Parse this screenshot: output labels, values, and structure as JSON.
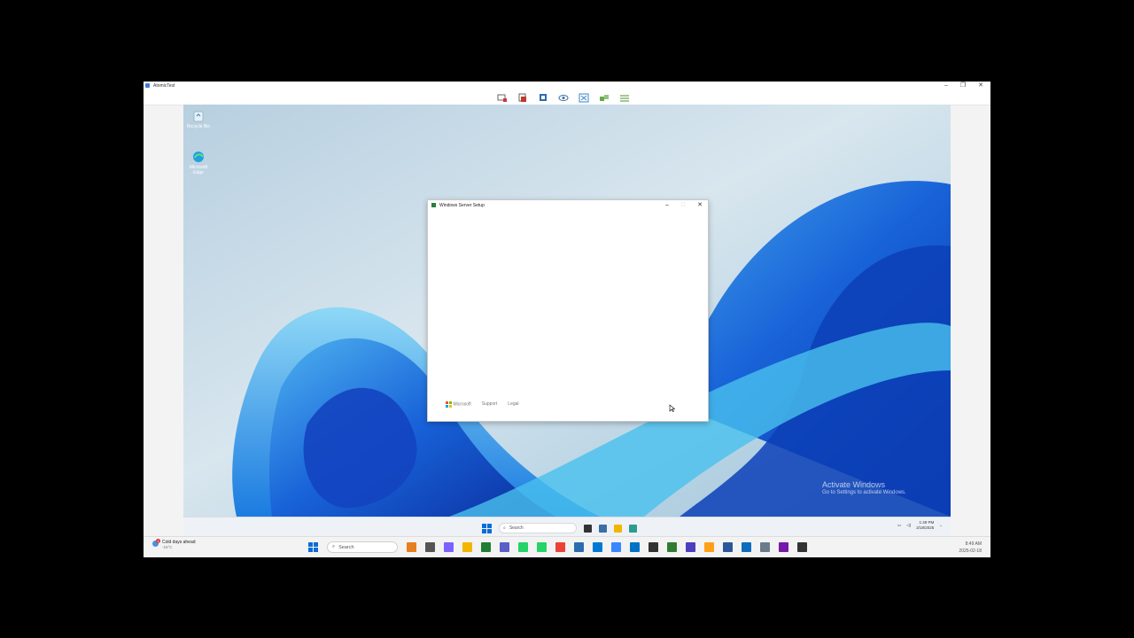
{
  "host_window": {
    "title": "AtomicTest",
    "controls": {
      "minimize": "–",
      "maximize": "❐",
      "close": "✕"
    },
    "toolbar_icons": [
      "ctrl-alt-del-icon",
      "turn-off-icon",
      "checkpoint-icon",
      "view-icon",
      "fullscreen-icon",
      "share-icon",
      "settings-icon"
    ]
  },
  "desktop": {
    "icons": [
      {
        "label": "Recycle Bin",
        "icon": "recycle-bin-icon"
      },
      {
        "label": "Microsoft Edge",
        "icon": "edge-icon"
      }
    ],
    "watermark": {
      "line1": "Activate Windows",
      "line2": "Go to Settings to activate Windows."
    }
  },
  "setup_dialog": {
    "title": "Windows Server Setup",
    "controls": {
      "minimize": "–",
      "maximize": "□",
      "close": "✕"
    },
    "footer": {
      "brand": "Microsoft",
      "support": "Support",
      "legal": "Legal"
    }
  },
  "vm_taskbar": {
    "search_placeholder": "Search",
    "pinned": [
      "task-view-icon",
      "server-manager-icon",
      "file-explorer-icon",
      "setup-icon"
    ],
    "time": "1:49 PM",
    "date": "2/18/2025"
  },
  "host_taskbar": {
    "weather": {
      "text": "Cold days ahead",
      "temp": "-15°C",
      "badge": "4"
    },
    "search_placeholder": "Search",
    "pinned_colors": [
      "#e67e22",
      "#555555",
      "#7b61ff",
      "#f2b600",
      "#1e7e34",
      "#5b5fc7",
      "#25d366",
      "#25d366",
      "#ea4335",
      "#2b6cb0",
      "#0078d4",
      "#3a86ff",
      "#0072c6",
      "#333333",
      "#2e7d32",
      "#4b3fbf",
      "#ff9f1a",
      "#2b579a",
      "#0f6cbd",
      "#6b7b8c",
      "#7719aa",
      "#333333"
    ],
    "time": "8:49 AM",
    "date": "2025-02-18"
  },
  "colors": {
    "accent": "#0a6cd6",
    "wallpaper_light": "#c9dbe8",
    "wallpaper_deep": "#0c3fb7"
  }
}
